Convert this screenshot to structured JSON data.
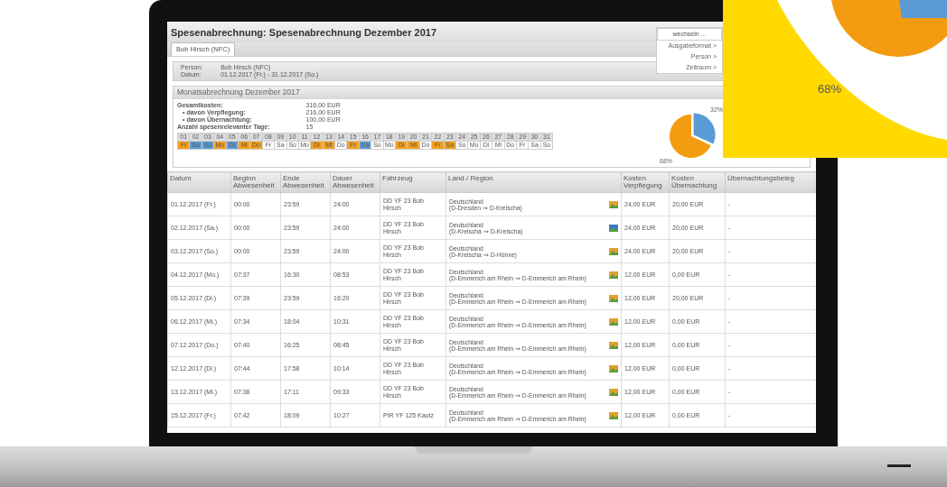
{
  "window": {
    "title": "Spesenabrechnung: Spesenabrechnung Dezember 2017"
  },
  "tabs": [
    {
      "label": "Bob Hirsch (NFC)",
      "selected": true
    }
  ],
  "menu": {
    "button": "wechseln ...",
    "items": [
      "Ausgabeformat >",
      "Person >",
      "Zeitraum >"
    ]
  },
  "info": [
    {
      "label": "Person:",
      "value": "Bob Hirsch (NFC)"
    },
    {
      "label": "Datum:",
      "value": "01.12.2017 (Fr.) - 31.12.2017 (So.)"
    }
  ],
  "section": {
    "title": "Monatsabrechnung Dezember 2017"
  },
  "summary": [
    {
      "label": "Gesamtkosten:",
      "value": "316,00 EUR",
      "indent": false
    },
    {
      "label": "• davon Verpflegung:",
      "value": "216,00 EUR",
      "indent": true
    },
    {
      "label": "• davon Übernachtung:",
      "value": "100,00 EUR",
      "indent": true
    },
    {
      "label": "Anzahl spesenrelevanter Tage:",
      "value": "15",
      "indent": false
    }
  ],
  "calendar": [
    {
      "day": "01",
      "weekday": "Fr",
      "color": "#f5a01a"
    },
    {
      "day": "02",
      "weekday": "Sa",
      "color": "#5b9bd5"
    },
    {
      "day": "03",
      "weekday": "So",
      "color": "#5b9bd5"
    },
    {
      "day": "04",
      "weekday": "Mo",
      "color": "#f5a01a"
    },
    {
      "day": "05",
      "weekday": "Di",
      "color": "#5b9bd5"
    },
    {
      "day": "06",
      "weekday": "Mi",
      "color": "#f5a01a"
    },
    {
      "day": "07",
      "weekday": "Do",
      "color": "#f5a01a"
    },
    {
      "day": "08",
      "weekday": "Fr"
    },
    {
      "day": "09",
      "weekday": "Sa"
    },
    {
      "day": "10",
      "weekday": "So"
    },
    {
      "day": "11",
      "weekday": "Mo"
    },
    {
      "day": "12",
      "weekday": "Di",
      "color": "#f5a01a"
    },
    {
      "day": "13",
      "weekday": "Mi",
      "color": "#f5a01a"
    },
    {
      "day": "14",
      "weekday": "Do"
    },
    {
      "day": "15",
      "weekday": "Fr",
      "color": "#f5a01a"
    },
    {
      "day": "16",
      "weekday": "Sa",
      "color": "#5b9bd5"
    },
    {
      "day": "17",
      "weekday": "So"
    },
    {
      "day": "18",
      "weekday": "Mo"
    },
    {
      "day": "19",
      "weekday": "Di",
      "color": "#f5a01a"
    },
    {
      "day": "20",
      "weekday": "Mi",
      "color": "#f5a01a"
    },
    {
      "day": "21",
      "weekday": "Do"
    },
    {
      "day": "22",
      "weekday": "Fr",
      "color": "#f5a01a"
    },
    {
      "day": "23",
      "weekday": "Sa",
      "color": "#f5a01a"
    },
    {
      "day": "24",
      "weekday": "So"
    },
    {
      "day": "25",
      "weekday": "Mo"
    },
    {
      "day": "26",
      "weekday": "Di"
    },
    {
      "day": "27",
      "weekday": "Mi"
    },
    {
      "day": "28",
      "weekday": "Do"
    },
    {
      "day": "29",
      "weekday": "Fr"
    },
    {
      "day": "30",
      "weekday": "Sa"
    },
    {
      "day": "31",
      "weekday": "So"
    }
  ],
  "pie": {
    "chart_data": {
      "type": "pie",
      "series": [
        {
          "values": [
            32,
            68
          ]
        }
      ],
      "value_labels": [
        "32%",
        "68%"
      ]
    }
  },
  "table": {
    "columns": [
      "Datum",
      "Beginn Abwesenheit",
      "Ende Abwesenheit",
      "Dauer Abwesenheit",
      "Fahrzeug",
      "Land / Region",
      "Kosten Verpflegung",
      "Kosten Übernachtung",
      "Übernachtungsbeleg"
    ],
    "rows": [
      {
        "date": "01.12.2017 (Fr.)",
        "begin": "00:00",
        "end": "23:59",
        "duration": "24:00",
        "vehicle": "DD YF 23 Bob Hirsch",
        "country": "Deutschland",
        "route": "(D-Dresden ⇒ D-Kreischa)",
        "meal": "24,00 EUR",
        "lodging": "20,00 EUR",
        "receipt": "-",
        "color": "#e0a030"
      },
      {
        "date": "02.12.2017 (Sa.)",
        "begin": "00:00",
        "end": "23:59",
        "duration": "24:00",
        "vehicle": "DD YF 23 Bob Hirsch",
        "country": "Deutschland",
        "route": "(D-Kreischa ⇒ D-Kreischa)",
        "meal": "24,00 EUR",
        "lodging": "20,00 EUR",
        "receipt": "-",
        "color": "#3a78c8"
      },
      {
        "date": "03.12.2017 (So.)",
        "begin": "00:00",
        "end": "23:59",
        "duration": "24:00",
        "vehicle": "DD YF 23 Bob Hirsch",
        "country": "Deutschland",
        "route": "(D-Kreischa ⇒ D-Hünxe)",
        "meal": "24,00 EUR",
        "lodging": "20,00 EUR",
        "receipt": "-",
        "color": "#e0a030"
      },
      {
        "date": "04.12.2017 (Mo.)",
        "begin": "07:37",
        "end": "16:30",
        "duration": "08:53",
        "vehicle": "DD YF 23 Bob Hirsch",
        "country": "Deutschland",
        "route": "(D-Emmerich am Rhein ⇒ D-Emmerich am Rhein)",
        "meal": "12,00 EUR",
        "lodging": "0,00 EUR",
        "receipt": "-",
        "color": "#e0a030"
      },
      {
        "date": "05.12.2017 (Di.)",
        "begin": "07:39",
        "end": "23:59",
        "duration": "16:20",
        "vehicle": "DD YF 23 Bob Hirsch",
        "country": "Deutschland",
        "route": "(D-Emmerich am Rhein ⇒ D-Emmerich am Rhein)",
        "meal": "12,00 EUR",
        "lodging": "20,00 EUR",
        "receipt": "-",
        "color": "#e0a030"
      },
      {
        "date": "06.12.2017 (Mi.)",
        "begin": "07:34",
        "end": "18:04",
        "duration": "10:31",
        "vehicle": "DD YF 23 Bob Hirsch",
        "country": "Deutschland",
        "route": "(D-Emmerich am Rhein ⇒ D-Emmerich am Rhein)",
        "meal": "12,00 EUR",
        "lodging": "0,00 EUR",
        "receipt": "-",
        "color": "#e0a030"
      },
      {
        "date": "07.12.2017 (Do.)",
        "begin": "07:40",
        "end": "16:25",
        "duration": "08:45",
        "vehicle": "DD YF 23 Bob Hirsch",
        "country": "Deutschland",
        "route": "(D-Emmerich am Rhein ⇒ D-Emmerich am Rhein)",
        "meal": "12,00 EUR",
        "lodging": "0,00 EUR",
        "receipt": "-",
        "color": "#e0a030"
      },
      {
        "date": "12.12.2017 (Di.)",
        "begin": "07:44",
        "end": "17:58",
        "duration": "10:14",
        "vehicle": "DD YF 23 Bob Hirsch",
        "country": "Deutschland",
        "route": "(D-Emmerich am Rhein ⇒ D-Emmerich am Rhein)",
        "meal": "12,00 EUR",
        "lodging": "0,00 EUR",
        "receipt": "-",
        "color": "#e0a030"
      },
      {
        "date": "13.12.2017 (Mi.)",
        "begin": "07:38",
        "end": "17:11",
        "duration": "09:33",
        "vehicle": "DD YF 23 Bob Hirsch",
        "country": "Deutschland",
        "route": "(D-Emmerich am Rhein ⇒ D-Emmerich am Rhein)",
        "meal": "12,00 EUR",
        "lodging": "0,00 EUR",
        "receipt": "-",
        "color": "#e0a030"
      },
      {
        "date": "15.12.2017 (Fr.)",
        "begin": "07:42",
        "end": "18:09",
        "duration": "10:27",
        "vehicle": "PIR YF 125 Kautz",
        "country": "Deutschland",
        "route": "(D-Emmerich am Rhein ⇒ D-Emmerich am Rhein)",
        "meal": "12,00 EUR",
        "lodging": "0,00 EUR",
        "receipt": "-",
        "color": "#e0a030"
      }
    ]
  },
  "callout": {
    "label": "68%"
  }
}
